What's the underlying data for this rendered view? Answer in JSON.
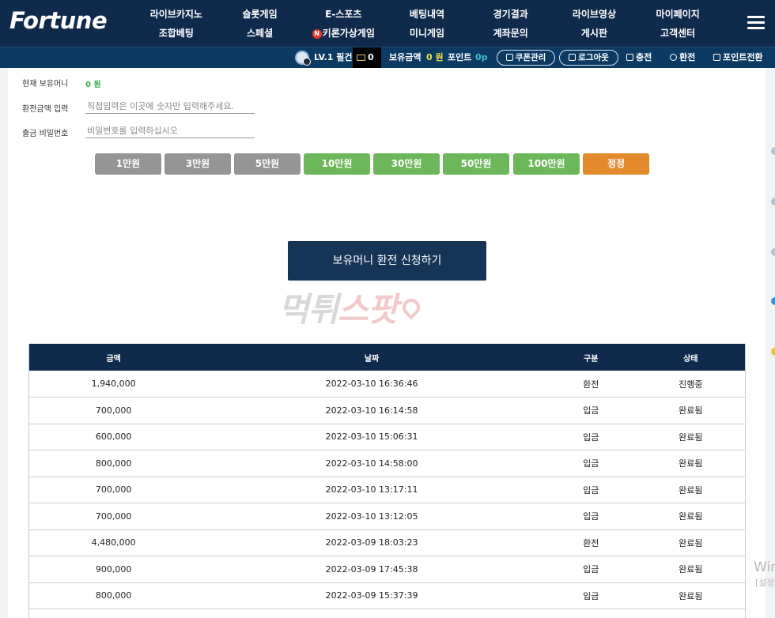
{
  "header": {
    "logo": "Fortune",
    "nav_row1": [
      "라이브카지노",
      "슬롯게임",
      "E-스포츠",
      "베팅내역",
      "경기결과",
      "라이브영상",
      "마이페이지"
    ],
    "nav_row2": [
      "조합베팅",
      "스페셜",
      "키론가상게임",
      "미니게임",
      "계좌문의",
      "게시판",
      "고객센터"
    ],
    "n_badge": "N"
  },
  "userbar": {
    "level": "LV.1 필건",
    "messages": "0",
    "money_label": "보유금액",
    "money_value": "0 원",
    "point_label": "포인트",
    "point_value": "0p",
    "coupon_btn": "쿠폰관리",
    "logout_btn": "로그아웃",
    "charge_link": "충전",
    "exchange_link": "환전",
    "point_exchange_link": "포인트전환"
  },
  "form": {
    "current_label": "현재 보유머니",
    "current_value": "0 원",
    "amount_label": "환전금액 입력",
    "amount_placeholder": "직접입력은 이곳에 숫자만 입력해주세요.",
    "password_label": "출금 비밀번호",
    "password_placeholder": "비밀번호를 입력하십시오"
  },
  "amount_buttons": [
    "1만원",
    "3만원",
    "5만원",
    "10만원",
    "30만원",
    "50만원",
    "100만원",
    "정정"
  ],
  "submit_label": "보유머니 환전 신청하기",
  "watermark": {
    "part1": "먹튀",
    "part2": "스팟"
  },
  "table": {
    "headers": [
      "금액",
      "날짜",
      "구분",
      "상태"
    ],
    "rows": [
      {
        "amount": "1,940,000",
        "date": "2022-03-10 16:36:46",
        "type": "환전",
        "status": "진행중"
      },
      {
        "amount": "700,000",
        "date": "2022-03-10 16:14:58",
        "type": "입금",
        "status": "완료됨"
      },
      {
        "amount": "600,000",
        "date": "2022-03-10 15:06:31",
        "type": "입금",
        "status": "완료됨"
      },
      {
        "amount": "800,000",
        "date": "2022-03-10 14:58:00",
        "type": "입금",
        "status": "완료됨"
      },
      {
        "amount": "700,000",
        "date": "2022-03-10 13:17:11",
        "type": "입금",
        "status": "완료됨"
      },
      {
        "amount": "700,000",
        "date": "2022-03-10 13:12:05",
        "type": "입금",
        "status": "완료됨"
      },
      {
        "amount": "4,480,000",
        "date": "2022-03-09 18:03:23",
        "type": "환전",
        "status": "완료됨"
      },
      {
        "amount": "900,000",
        "date": "2022-03-09 17:45:38",
        "type": "입금",
        "status": "완료됨"
      },
      {
        "amount": "800,000",
        "date": "2022-03-09 15:37:39",
        "type": "입금",
        "status": "완료됨"
      }
    ]
  },
  "os_watermark": {
    "line1": "Win",
    "line2": "[설정"
  },
  "colors": {
    "header_bg": "#0f2a4b",
    "userbar_bg": "#0c3a63",
    "money_accent": "#f1e24a",
    "point_accent": "#3fc0c9",
    "status_done": "#3aa54a",
    "status_progress": "#e05a2b",
    "btn_gray": "#959595",
    "btn_green": "#6db75b",
    "btn_orange": "#e38a2d"
  }
}
